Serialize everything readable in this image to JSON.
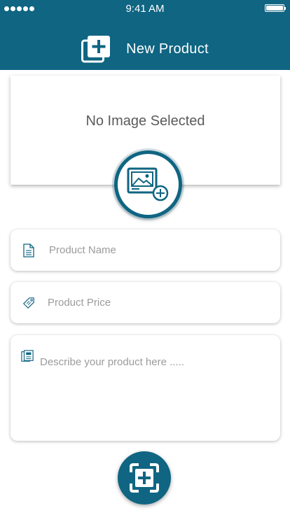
{
  "status_bar": {
    "time": "9:41 AM",
    "signal_icon": "signal-dots-icon",
    "battery_icon": "battery-icon"
  },
  "header": {
    "title": "New Product",
    "icon": "add-item-icon",
    "background_color": "#0f6582"
  },
  "image_picker": {
    "empty_text": "No Image Selected",
    "button_icon": "add-image-icon"
  },
  "form": {
    "product_name": {
      "placeholder": "Product Name",
      "value": "",
      "icon": "document-icon"
    },
    "product_price": {
      "placeholder": "Product Price",
      "value": "",
      "icon": "price-tag-icon"
    },
    "description": {
      "placeholder": "Describe your product here .....",
      "value": "",
      "icon": "notes-icon"
    }
  },
  "submit_button": {
    "icon": "add-frame-icon"
  },
  "colors": {
    "primary": "#0f6582",
    "placeholder": "#9b9b9b",
    "text": "#5b5b5b"
  }
}
